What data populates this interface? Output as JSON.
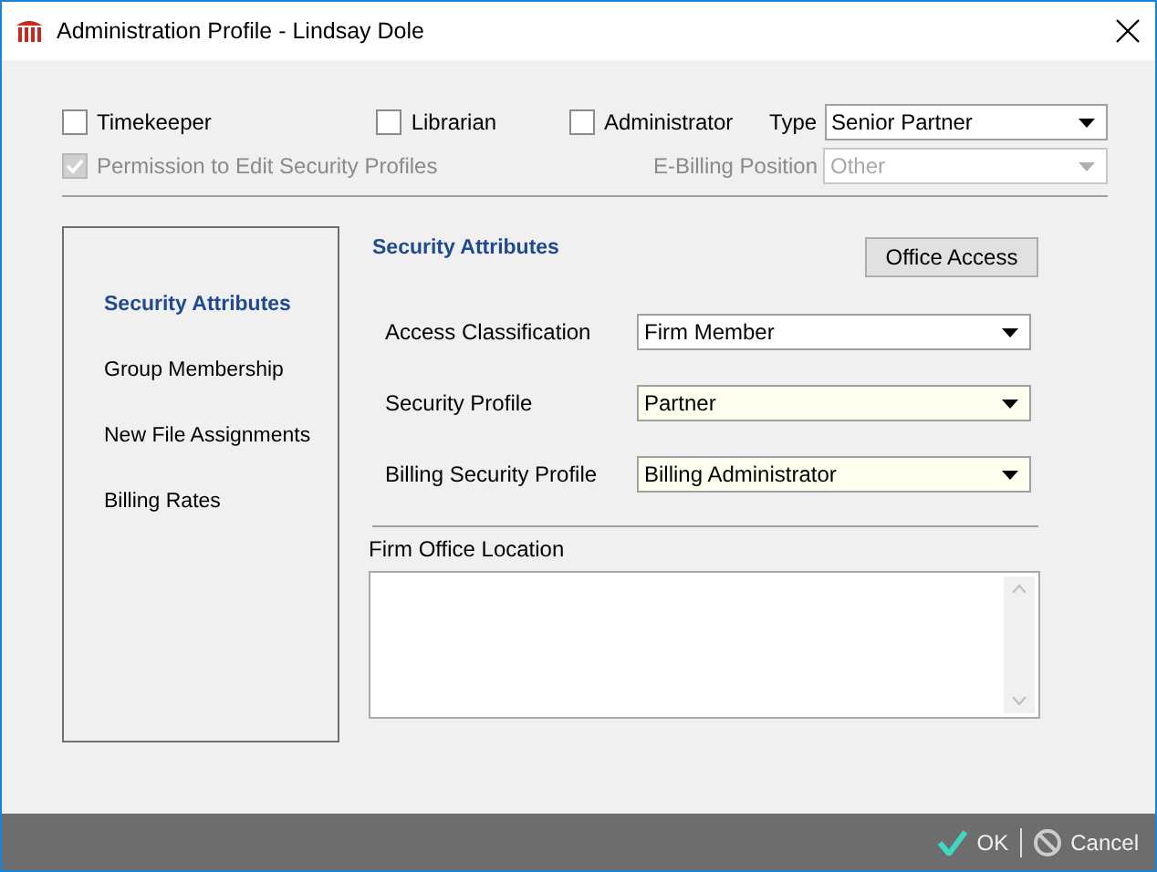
{
  "window": {
    "title": "Administration Profile - Lindsay Dole"
  },
  "roles": [
    {
      "label": "Timekeeper",
      "checked": false
    },
    {
      "label": "Librarian",
      "checked": false
    },
    {
      "label": "Administrator",
      "checked": false
    }
  ],
  "type": {
    "label": "Type",
    "value": "Senior Partner",
    "disabled": false
  },
  "permission": {
    "label": "Permission to Edit Security Profiles",
    "checked": true,
    "disabled": true
  },
  "ebilling": {
    "label": "E-Billing Position",
    "value": "Other",
    "disabled": true
  },
  "nav": [
    {
      "label": "Security Attributes",
      "selected": true
    },
    {
      "label": "Group Membership",
      "selected": false
    },
    {
      "label": "New File Assignments",
      "selected": false
    },
    {
      "label": "Billing Rates",
      "selected": false
    }
  ],
  "section": {
    "title": "Security Attributes",
    "button": "Office Access"
  },
  "fields": [
    {
      "label": "Access Classification",
      "value": "Firm Member",
      "highlighted": false
    },
    {
      "label": "Security Profile",
      "value": "Partner",
      "highlighted": true
    },
    {
      "label": "Billing Security Profile",
      "value": "Billing Administrator",
      "highlighted": true
    }
  ],
  "location": {
    "label": "Firm Office Location"
  },
  "footer": {
    "ok": "OK",
    "cancel": "Cancel"
  }
}
